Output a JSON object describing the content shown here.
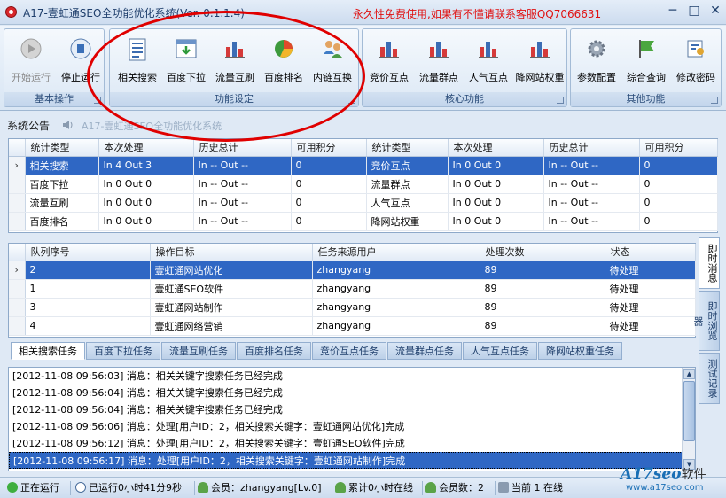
{
  "window": {
    "title": "A17-壹虹通SEO全功能优化系统(Ver. 0.1.1.4)",
    "notice": "永久性免费使用,如果有不懂请联系客服QQ7066631",
    "controls": [
      "─",
      "□",
      "✕"
    ]
  },
  "ribbon": {
    "groups": [
      {
        "label": "基本操作",
        "buttons": [
          {
            "label": "开始运行",
            "icon": "play-icon",
            "disabled": true
          },
          {
            "label": "停止运行",
            "icon": "stop-icon",
            "disabled": false
          }
        ]
      },
      {
        "label": "功能设定",
        "buttons": [
          {
            "label": "相关搜索",
            "icon": "document-list-icon"
          },
          {
            "label": "百度下拉",
            "icon": "download-window-icon"
          },
          {
            "label": "流量互刷",
            "icon": "traffic-bars-icon"
          },
          {
            "label": "百度排名",
            "icon": "pie-chart-icon"
          },
          {
            "label": "内链互换",
            "icon": "users-swap-icon"
          }
        ]
      },
      {
        "label": "核心功能",
        "buttons": [
          {
            "label": "竞价互点",
            "icon": "bid-bars-icon"
          },
          {
            "label": "流量群点",
            "icon": "group-bars-icon"
          },
          {
            "label": "人气互点",
            "icon": "popularity-bars-icon"
          },
          {
            "label": "降网站权重",
            "icon": "lower-weight-icon"
          }
        ]
      },
      {
        "label": "其他功能",
        "buttons": [
          {
            "label": "参数配置",
            "icon": "gear-icon"
          },
          {
            "label": "综合查询",
            "icon": "flag-icon"
          },
          {
            "label": "修改密码",
            "icon": "password-icon"
          }
        ]
      }
    ]
  },
  "announcement": {
    "label": "系统公告",
    "text": "A17-壹虹通SEO全功能优化系统"
  },
  "stats": {
    "headers": [
      "统计类型",
      "本次处理",
      "历史总计",
      "可用积分",
      "统计类型",
      "本次处理",
      "历史总计",
      "可用积分"
    ],
    "rows": [
      [
        "相关搜索",
        "In 4    Out 3",
        "In --    Out --",
        "0",
        "竞价互点",
        "In 0    Out 0",
        "In --    Out --",
        "0"
      ],
      [
        "百度下拉",
        "In 0    Out 0",
        "In --    Out --",
        "0",
        "流量群点",
        "In 0    Out 0",
        "In --    Out --",
        "0"
      ],
      [
        "流量互刷",
        "In 0    Out 0",
        "In --    Out --",
        "0",
        "人气互点",
        "In 0    Out 0",
        "In --    Out --",
        "0"
      ],
      [
        "百度排名",
        "In 0    Out 0",
        "In --    Out --",
        "0",
        "降网站权重",
        "In 0    Out 0",
        "In --    Out --",
        "0"
      ]
    ],
    "selected_row": 0
  },
  "queue": {
    "headers": [
      "队列序号",
      "操作目标",
      "任务来源用户",
      "处理次数",
      "状态"
    ],
    "rows": [
      [
        "2",
        "壹虹通网站优化",
        "zhangyang",
        "89",
        "待处理"
      ],
      [
        "1",
        "壹虹通SEO软件",
        "zhangyang",
        "89",
        "待处理"
      ],
      [
        "3",
        "壹虹通网站制作",
        "zhangyang",
        "89",
        "待处理"
      ],
      [
        "4",
        "壹虹通网络营销",
        "zhangyang",
        "89",
        "待处理"
      ]
    ],
    "selected_row": 0
  },
  "task_tabs": [
    "相关搜索任务",
    "百度下拉任务",
    "流量互刷任务",
    "百度排名任务",
    "竞价互点任务",
    "流量群点任务",
    "人气互点任务",
    "降网站权重任务"
  ],
  "active_task_tab": 0,
  "log": [
    "[2012-11-08 09:56:03] 消息：相关关键字搜索任务已经完成",
    "[2012-11-08 09:56:04] 消息：相关关键字搜索任务已经完成",
    "[2012-11-08 09:56:04] 消息：相关关键字搜索任务已经完成",
    "[2012-11-08 09:56:06] 消息：处理[用户ID：2，相关搜索关键字：壹虹通网站优化]完成",
    "[2012-11-08 09:56:12] 消息：处理[用户ID：2，相关搜索关键字：壹虹通SEO软件]完成",
    "[2012-11-08 09:56:17] 消息：处理[用户ID：2，相关搜索关键字：壹虹通网站制作]完成"
  ],
  "side_tabs": [
    "即时消息",
    "即时浏览器",
    "测试记录"
  ],
  "status": {
    "running": "正在运行",
    "uptime": "已运行0小时41分9秒",
    "member": "会员：zhangyang[Lv.0]",
    "online_total": "累计0小时在线",
    "member_count": "会员数：2",
    "current_online": "当前 1 在线"
  },
  "branding": {
    "logo": "A17seo",
    "logo_suffix": "软件",
    "url": "www.a17seo.com"
  },
  "colors": {
    "selection": "#2f67c4",
    "notice": "#e01010",
    "annotation": "#e00000"
  }
}
